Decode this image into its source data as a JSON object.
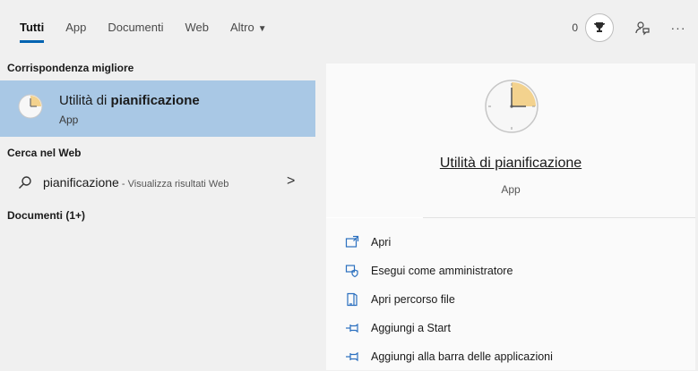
{
  "tabs": [
    {
      "label": "Tutti",
      "active": true
    },
    {
      "label": "App",
      "active": false
    },
    {
      "label": "Documenti",
      "active": false
    },
    {
      "label": "Web",
      "active": false
    },
    {
      "label": "Altro",
      "active": false
    }
  ],
  "top_right": {
    "points": "0",
    "trophy_icon": "trophy-icon",
    "feedback_icon": "feedback-icon",
    "more_icon": "more-icon"
  },
  "best_match": {
    "header": "Corrispondenza migliore",
    "title_prefix": "Utilità di ",
    "title_bold": "pianificazione",
    "subtitle": "App",
    "icon": "clock-icon"
  },
  "web_search": {
    "header": "Cerca nel Web",
    "query": "pianificazione",
    "hint": " - Visualizza risultati Web",
    "icon": "search-icon"
  },
  "documents": {
    "header": "Documenti (1+)"
  },
  "detail": {
    "app_name": "Utilità di pianificazione",
    "app_type": "App",
    "actions": [
      {
        "label": "Apri",
        "icon": "open-icon"
      },
      {
        "label": "Esegui come amministratore",
        "icon": "run-as-admin-icon"
      },
      {
        "label": "Apri percorso file",
        "icon": "open-file-location-icon"
      },
      {
        "label": "Aggiungi a Start",
        "icon": "pin-icon"
      },
      {
        "label": "Aggiungi alla barra delle applicazioni",
        "icon": "pin-icon"
      }
    ]
  },
  "colors": {
    "accent": "#0063b1",
    "selected_bg": "#a9c8e5",
    "pane_bg": "#fafafa",
    "bg": "#f0f0f0"
  }
}
